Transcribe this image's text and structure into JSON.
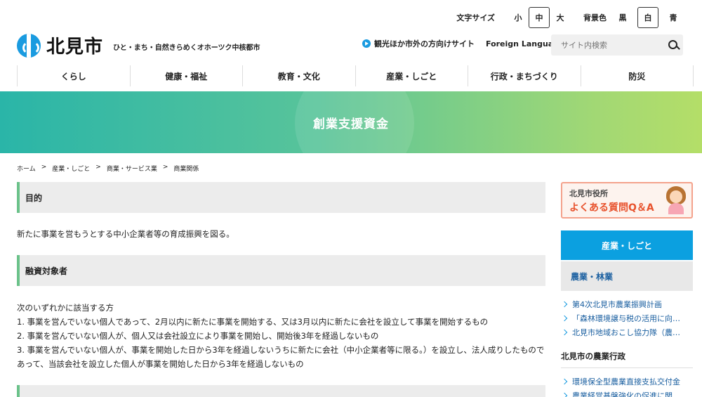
{
  "util": {
    "font_size_label": "文字サイズ",
    "font_sizes": [
      "小",
      "中",
      "大"
    ],
    "font_size_selected": "中",
    "bg_label": "背景色",
    "bg_options": [
      "黒",
      "白",
      "青"
    ],
    "bg_selected": "白"
  },
  "header": {
    "logo_name": "北見市",
    "tagline": "ひと・まち・自然きらめくオホーツク中核都市",
    "tourism_link": "観光ほか市外の方向けサイト",
    "foreign_link": "Foreign Language",
    "search_placeholder": "サイト内検索"
  },
  "nav": [
    "くらし",
    "健康・福祉",
    "教育・文化",
    "産業・しごと",
    "行政・まちづくり",
    "防災"
  ],
  "banner": {
    "title": "創業支援資金"
  },
  "breadcrumb": [
    "ホーム",
    "産業・しごと",
    "商業・サービス業",
    "商業関係"
  ],
  "main": {
    "section1_heading": "目的",
    "section1_text": "新たに事業を営もうとする中小企業者等の育成振興を図る。",
    "section2_heading": "融資対象者",
    "section2_intro": "次のいずれかに該当する方",
    "section2_items": [
      "1. 事業を営んでいない個人であって、2月以内に新たに事業を開始する、又は3月以内に新たに会社を設立して事業を開始するもの",
      "2. 事業を営んでいない個人が、個人又は会社設立により事業を開始し、開始後3年を経過しないもの",
      "3. 事業を営んでいない個人が、事業を開始した日から3年を経過しないうちに新たに会社（中小企業者等に限る。）を設立し、法人成りしたものであって、当該会社を設立した個人が事業を開始した日から3年を経過しないもの"
    ]
  },
  "sidebar": {
    "qa_line1": "北見市役所",
    "qa_line2": "よくある質問Q＆A",
    "category": "産業・しごと",
    "subcategory": "農業・林業",
    "links": [
      "第4次北見市農業振興計画",
      "「森林環境譲与税の活用に向…",
      "北見市地域おこし協力隊（農…"
    ],
    "section_title": "北見市の農業行政",
    "section_links": [
      "環境保全型農業直接支払交付金",
      "農業経営基盤強化の促進に関…"
    ]
  },
  "colors": {
    "brand_blue": "#1a9be0",
    "banner_start": "#2ab5a8",
    "banner_end": "#b4de68",
    "heading_accent": "#6bc28a",
    "link": "#1a5fa0",
    "qa_accent": "#e8532e"
  }
}
